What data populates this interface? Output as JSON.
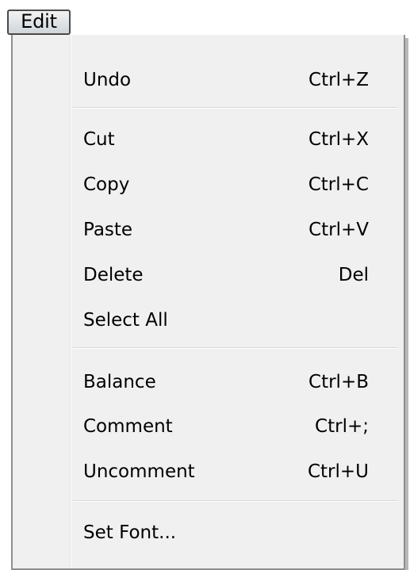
{
  "menu": {
    "title": "Edit",
    "items": {
      "undo": {
        "label": "Undo",
        "shortcut": "Ctrl+Z"
      },
      "cut": {
        "label": "Cut",
        "shortcut": "Ctrl+X"
      },
      "copy": {
        "label": "Copy",
        "shortcut": "Ctrl+C"
      },
      "paste": {
        "label": "Paste",
        "shortcut": "Ctrl+V"
      },
      "delete": {
        "label": "Delete",
        "shortcut": "Del"
      },
      "select_all": {
        "label": "Select All",
        "shortcut": ""
      },
      "balance": {
        "label": "Balance",
        "shortcut": "Ctrl+B"
      },
      "comment": {
        "label": "Comment",
        "shortcut": "Ctrl+;"
      },
      "uncomment": {
        "label": "Uncomment",
        "shortcut": "Ctrl+U"
      },
      "set_font": {
        "label": "Set Font...",
        "shortcut": ""
      }
    }
  },
  "colors": {
    "menu_background": "#f0f0f0",
    "menu_border": "#8f8f8f",
    "title_border": "#4a4a4a",
    "separator": "#d8d8d8",
    "text": "#000000"
  }
}
